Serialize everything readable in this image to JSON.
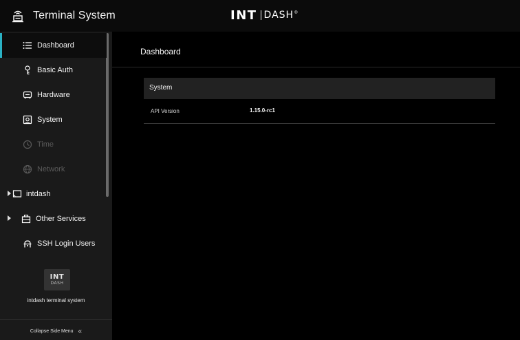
{
  "header": {
    "app_title": "Terminal System",
    "logo_int": "INT",
    "logo_dash": "DASH",
    "logo_reg": "®"
  },
  "sidebar": {
    "items": [
      {
        "label": "Dashboard",
        "icon": "list-icon",
        "state": "active"
      },
      {
        "label": "Basic Auth",
        "icon": "key-icon",
        "state": "enabled"
      },
      {
        "label": "Hardware",
        "icon": "hardware-icon",
        "state": "enabled"
      },
      {
        "label": "System",
        "icon": "system-icon",
        "state": "enabled"
      },
      {
        "label": "Time",
        "icon": "clock-icon",
        "state": "disabled"
      },
      {
        "label": "Network",
        "icon": "globe-icon",
        "state": "disabled"
      },
      {
        "label": "intdash",
        "icon": "cast-icon",
        "state": "collapsed-group"
      },
      {
        "label": "Other Services",
        "icon": "services-icon",
        "state": "collapsed-group"
      },
      {
        "label": "SSH Login Users",
        "icon": "user-lock-icon",
        "state": "enabled"
      }
    ],
    "logo_int": "INT",
    "logo_dash": "DASH",
    "caption": "intdash terminal system",
    "collapse_label": "Collapse Side Menu",
    "collapse_icon": "double-chevron-left-icon"
  },
  "main": {
    "page_title": "Dashboard",
    "panel_title": "System",
    "rows": [
      {
        "key": "API Version",
        "value": "1.15.0-rc1"
      }
    ]
  },
  "colors": {
    "accent": "#2ab1c4",
    "sidebar_bg": "#1a1a1a",
    "main_bg": "#000000",
    "panel_header_bg": "#222222"
  }
}
